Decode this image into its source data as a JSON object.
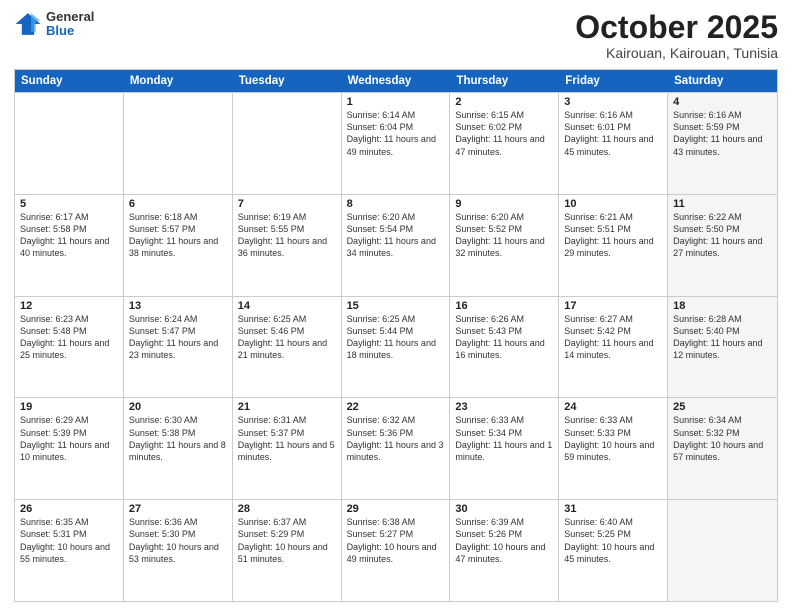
{
  "logo": {
    "general": "General",
    "blue": "Blue"
  },
  "header": {
    "month": "October 2025",
    "location": "Kairouan, Kairouan, Tunisia"
  },
  "weekdays": [
    "Sunday",
    "Monday",
    "Tuesday",
    "Wednesday",
    "Thursday",
    "Friday",
    "Saturday"
  ],
  "rows": [
    [
      {
        "day": "",
        "info": "",
        "shaded": false
      },
      {
        "day": "",
        "info": "",
        "shaded": false
      },
      {
        "day": "",
        "info": "",
        "shaded": false
      },
      {
        "day": "1",
        "info": "Sunrise: 6:14 AM\nSunset: 6:04 PM\nDaylight: 11 hours and 49 minutes.",
        "shaded": false
      },
      {
        "day": "2",
        "info": "Sunrise: 6:15 AM\nSunset: 6:02 PM\nDaylight: 11 hours and 47 minutes.",
        "shaded": false
      },
      {
        "day": "3",
        "info": "Sunrise: 6:16 AM\nSunset: 6:01 PM\nDaylight: 11 hours and 45 minutes.",
        "shaded": false
      },
      {
        "day": "4",
        "info": "Sunrise: 6:16 AM\nSunset: 5:59 PM\nDaylight: 11 hours and 43 minutes.",
        "shaded": true
      }
    ],
    [
      {
        "day": "5",
        "info": "Sunrise: 6:17 AM\nSunset: 5:58 PM\nDaylight: 11 hours and 40 minutes.",
        "shaded": false
      },
      {
        "day": "6",
        "info": "Sunrise: 6:18 AM\nSunset: 5:57 PM\nDaylight: 11 hours and 38 minutes.",
        "shaded": false
      },
      {
        "day": "7",
        "info": "Sunrise: 6:19 AM\nSunset: 5:55 PM\nDaylight: 11 hours and 36 minutes.",
        "shaded": false
      },
      {
        "day": "8",
        "info": "Sunrise: 6:20 AM\nSunset: 5:54 PM\nDaylight: 11 hours and 34 minutes.",
        "shaded": false
      },
      {
        "day": "9",
        "info": "Sunrise: 6:20 AM\nSunset: 5:52 PM\nDaylight: 11 hours and 32 minutes.",
        "shaded": false
      },
      {
        "day": "10",
        "info": "Sunrise: 6:21 AM\nSunset: 5:51 PM\nDaylight: 11 hours and 29 minutes.",
        "shaded": false
      },
      {
        "day": "11",
        "info": "Sunrise: 6:22 AM\nSunset: 5:50 PM\nDaylight: 11 hours and 27 minutes.",
        "shaded": true
      }
    ],
    [
      {
        "day": "12",
        "info": "Sunrise: 6:23 AM\nSunset: 5:48 PM\nDaylight: 11 hours and 25 minutes.",
        "shaded": false
      },
      {
        "day": "13",
        "info": "Sunrise: 6:24 AM\nSunset: 5:47 PM\nDaylight: 11 hours and 23 minutes.",
        "shaded": false
      },
      {
        "day": "14",
        "info": "Sunrise: 6:25 AM\nSunset: 5:46 PM\nDaylight: 11 hours and 21 minutes.",
        "shaded": false
      },
      {
        "day": "15",
        "info": "Sunrise: 6:25 AM\nSunset: 5:44 PM\nDaylight: 11 hours and 18 minutes.",
        "shaded": false
      },
      {
        "day": "16",
        "info": "Sunrise: 6:26 AM\nSunset: 5:43 PM\nDaylight: 11 hours and 16 minutes.",
        "shaded": false
      },
      {
        "day": "17",
        "info": "Sunrise: 6:27 AM\nSunset: 5:42 PM\nDaylight: 11 hours and 14 minutes.",
        "shaded": false
      },
      {
        "day": "18",
        "info": "Sunrise: 6:28 AM\nSunset: 5:40 PM\nDaylight: 11 hours and 12 minutes.",
        "shaded": true
      }
    ],
    [
      {
        "day": "19",
        "info": "Sunrise: 6:29 AM\nSunset: 5:39 PM\nDaylight: 11 hours and 10 minutes.",
        "shaded": false
      },
      {
        "day": "20",
        "info": "Sunrise: 6:30 AM\nSunset: 5:38 PM\nDaylight: 11 hours and 8 minutes.",
        "shaded": false
      },
      {
        "day": "21",
        "info": "Sunrise: 6:31 AM\nSunset: 5:37 PM\nDaylight: 11 hours and 5 minutes.",
        "shaded": false
      },
      {
        "day": "22",
        "info": "Sunrise: 6:32 AM\nSunset: 5:36 PM\nDaylight: 11 hours and 3 minutes.",
        "shaded": false
      },
      {
        "day": "23",
        "info": "Sunrise: 6:33 AM\nSunset: 5:34 PM\nDaylight: 11 hours and 1 minute.",
        "shaded": false
      },
      {
        "day": "24",
        "info": "Sunrise: 6:33 AM\nSunset: 5:33 PM\nDaylight: 10 hours and 59 minutes.",
        "shaded": false
      },
      {
        "day": "25",
        "info": "Sunrise: 6:34 AM\nSunset: 5:32 PM\nDaylight: 10 hours and 57 minutes.",
        "shaded": true
      }
    ],
    [
      {
        "day": "26",
        "info": "Sunrise: 6:35 AM\nSunset: 5:31 PM\nDaylight: 10 hours and 55 minutes.",
        "shaded": false
      },
      {
        "day": "27",
        "info": "Sunrise: 6:36 AM\nSunset: 5:30 PM\nDaylight: 10 hours and 53 minutes.",
        "shaded": false
      },
      {
        "day": "28",
        "info": "Sunrise: 6:37 AM\nSunset: 5:29 PM\nDaylight: 10 hours and 51 minutes.",
        "shaded": false
      },
      {
        "day": "29",
        "info": "Sunrise: 6:38 AM\nSunset: 5:27 PM\nDaylight: 10 hours and 49 minutes.",
        "shaded": false
      },
      {
        "day": "30",
        "info": "Sunrise: 6:39 AM\nSunset: 5:26 PM\nDaylight: 10 hours and 47 minutes.",
        "shaded": false
      },
      {
        "day": "31",
        "info": "Sunrise: 6:40 AM\nSunset: 5:25 PM\nDaylight: 10 hours and 45 minutes.",
        "shaded": false
      },
      {
        "day": "",
        "info": "",
        "shaded": true
      }
    ]
  ]
}
